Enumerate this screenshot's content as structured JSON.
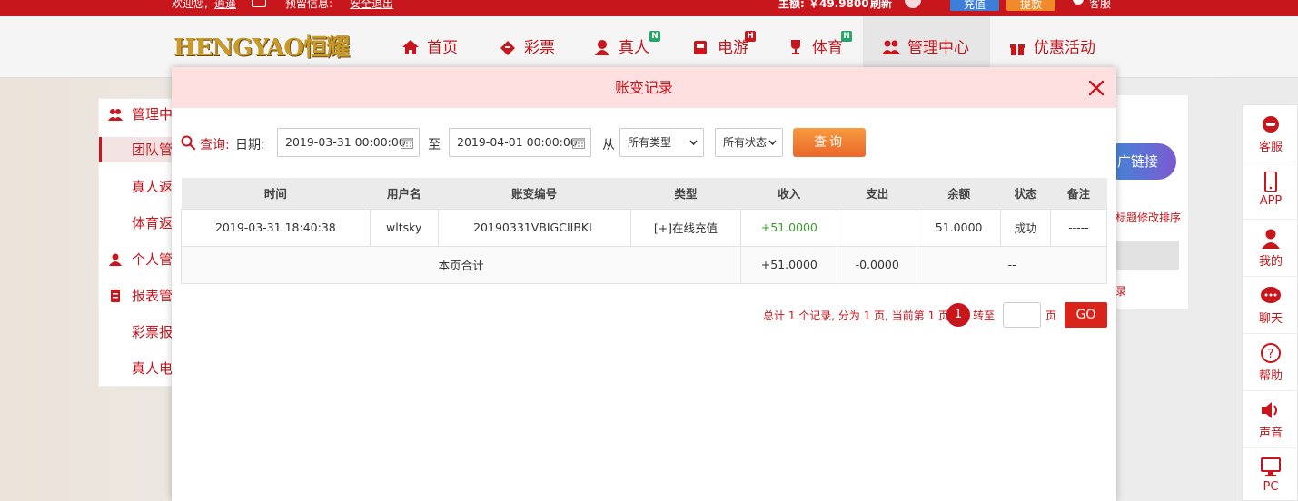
{
  "topbar": {
    "welcome": "欢迎您,",
    "username": "逍遥",
    "message": "预留信息:",
    "logout": "安全退出",
    "balance": "主额: ￥49.9800",
    "refresh": "刷新",
    "deposit": "充值",
    "withdraw": "提款",
    "service": "客服"
  },
  "nav": {
    "logo": "HENGYAO恒耀",
    "items": [
      {
        "label": "首页",
        "icon": "home-icon"
      },
      {
        "label": "彩票",
        "icon": "ticket-icon"
      },
      {
        "label": "真人",
        "icon": "live-dealer-icon",
        "tag": "N"
      },
      {
        "label": "电游",
        "icon": "slot-machine-icon",
        "tag": "H"
      },
      {
        "label": "体育",
        "icon": "trophy-icon",
        "tag": "N"
      },
      {
        "label": "管理中心",
        "icon": "users-icon"
      },
      {
        "label": "优惠活动",
        "icon": "gift-icon"
      }
    ]
  },
  "leftmenu": {
    "items": [
      "管理中心",
      "团队管理",
      "真人返",
      "体育返",
      "个人管",
      "报表管",
      "彩票报",
      "真人电"
    ]
  },
  "background": {
    "promo": "广链接",
    "promo_note": "标题修改排序",
    "record_link": "录"
  },
  "floatbar": {
    "items": [
      "客服",
      "APP",
      "我的",
      "聊天",
      "帮助",
      "声音",
      "PC"
    ]
  },
  "modal": {
    "title": "账变记录",
    "filter": {
      "query_label": "查询:",
      "date_label": "日期:",
      "start_date": "2019-03-31 00:00:00",
      "to_label": "至",
      "end_date": "2019-04-01 00:00:00",
      "from_label": "从",
      "type_select": "所有类型",
      "status_select": "所有状态",
      "query_button": "查询"
    },
    "table": {
      "headers": [
        "时间",
        "用户名",
        "账变编号",
        "类型",
        "收入",
        "支出",
        "余额",
        "状态",
        "备注"
      ],
      "rows": [
        [
          "2019-03-31 18:40:38",
          "wltsky",
          "20190331VBIGCIIBKL",
          "[+]在线充值",
          "+51.0000",
          "",
          "51.0000",
          "成功",
          "-----"
        ]
      ],
      "summary": {
        "label": "本页合计",
        "income": "+51.0000",
        "expense": "-0.0000",
        "rest": "--"
      }
    },
    "pager": {
      "info": "总计 1 个记录, 分为 1 页, 当前第 1 页",
      "current": "1",
      "goto": "转至",
      "page_unit": "页",
      "go": "GO"
    }
  },
  "colors": {
    "brand_red": "#c8161d",
    "income_green": "#3a9c2e",
    "query_orange": "#e9672a",
    "modal_header_bg": "#ffe0e0"
  }
}
